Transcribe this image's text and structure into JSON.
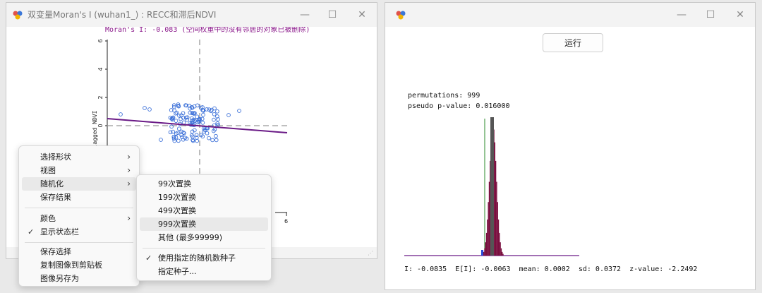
{
  "left_window": {
    "title": "双变量Moran's I (wuhan1_) : RECC和滞后NDVI",
    "minimize": "—",
    "maximize": "☐",
    "close": "✕",
    "plot_title": "Moran's I: -0.083 (空间权重中的没有邻居的对象已被删除)",
    "ylabel": "lagged NDVI",
    "yticks": [
      "6",
      "4",
      "2",
      "0"
    ],
    "xtick_right": "6"
  },
  "context_menu": {
    "items": [
      {
        "label": "选择形状",
        "submenu": true,
        "checked": false
      },
      {
        "label": "视图",
        "submenu": true,
        "checked": false
      },
      {
        "label": "随机化",
        "submenu": true,
        "checked": false,
        "highlighted": true
      },
      {
        "label": "保存结果",
        "submenu": false,
        "checked": false
      },
      {
        "label": "颜色",
        "submenu": true,
        "checked": false
      },
      {
        "label": "显示状态栏",
        "submenu": false,
        "checked": true
      },
      {
        "label": "保存选择",
        "submenu": false,
        "checked": false
      },
      {
        "label": "复制图像到剪贴板",
        "submenu": false,
        "checked": false
      },
      {
        "label": "图像另存为",
        "submenu": false,
        "checked": false
      }
    ],
    "checkmark": "✓",
    "arrow": "›"
  },
  "submenu": {
    "items": [
      {
        "label": "99次置换",
        "checked": false
      },
      {
        "label": "199次置换",
        "checked": false
      },
      {
        "label": "499次置换",
        "checked": false
      },
      {
        "label": "999次置换",
        "checked": false,
        "highlighted": true
      },
      {
        "label": "其他 (最多99999)",
        "checked": false
      },
      {
        "label": "使用指定的随机数种子",
        "checked": true
      },
      {
        "label": "指定种子...",
        "checked": false
      }
    ]
  },
  "right_window": {
    "minimize": "—",
    "maximize": "☐",
    "close": "✕",
    "run_button": "运行",
    "permutations": "permutations: 999",
    "pseudo_p": "pseudo p-value: 0.016000",
    "stats": "I: -0.0835  E[I]: -0.0063  mean: 0.0002  sd: 0.0372  z-value: -2.2492"
  },
  "colors": {
    "regression_line": "#6a1a86",
    "histogram": "#7a0f3f",
    "point_stroke": "#3a6fd8",
    "observed_line": "#2a8a2a"
  }
}
